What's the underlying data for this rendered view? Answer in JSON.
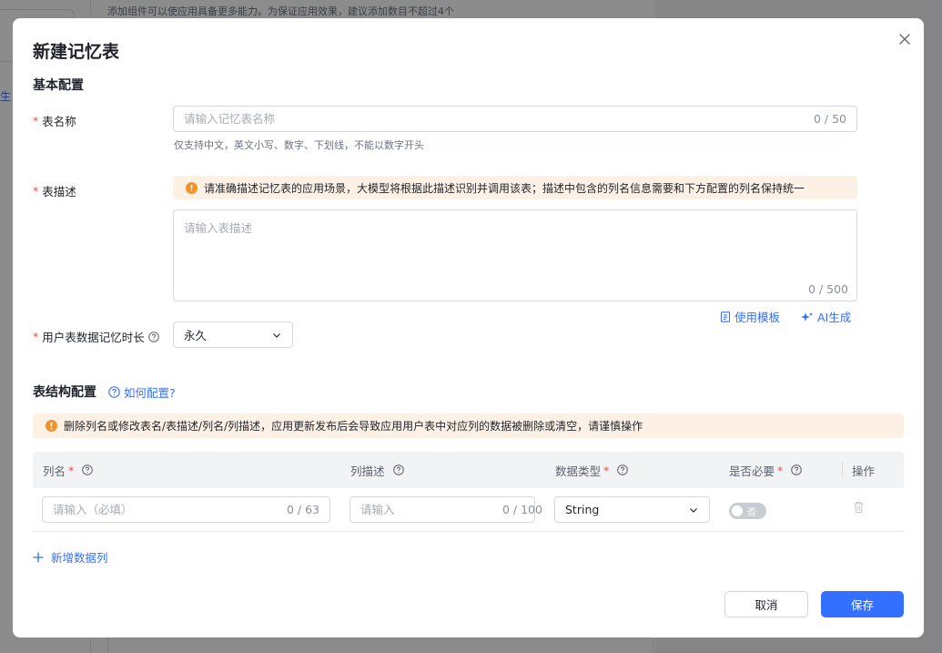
{
  "background": {
    "hint": "添加组件可以使应用具备更多能力。为保证应用效果，建议添加数目不超过4个",
    "left_text": "生"
  },
  "modal": {
    "title": "新建记忆表",
    "close_icon": "close-icon"
  },
  "basic": {
    "section_title": "基本配置",
    "required_mark": "*",
    "name": {
      "label": "表名称",
      "placeholder": "请输入记忆表名称",
      "value": "",
      "counter": "0 / 50",
      "hint": "仅支持中文，英文小写、数字、下划线，不能以数字开头"
    },
    "description": {
      "label": "表描述",
      "warning": "请准确描述记忆表的应用场景，大模型将根据此描述识别并调用该表；描述中包含的列名信息需要和下方配置的列名保持统一",
      "placeholder": "请输入表描述",
      "value": "",
      "counter": "0 / 500",
      "use_template": "使用模板",
      "ai_generate": "AI生成"
    },
    "retention": {
      "label": "用户表数据记忆时长",
      "selected": "永久"
    }
  },
  "structure": {
    "section_title": "表结构配置",
    "help_link": "如何配置?",
    "warning": "删除列名或修改表名/表描述/列名/列描述，应用更新发布后会导致应用用户表中对应列的数据被删除或清空，请谨慎操作",
    "columns": {
      "name": "列名",
      "desc": "列描述",
      "type": "数据类型",
      "required": "是否必要",
      "action": "操作"
    },
    "rows": [
      {
        "name_placeholder": "请输入（必填）",
        "name_counter": "0 / 63",
        "desc_placeholder": "请输入",
        "desc_counter": "0 / 100",
        "type": "String",
        "required_label": "否",
        "required_on": false
      }
    ],
    "add_column": "新增数据列"
  },
  "footer": {
    "cancel": "取消",
    "save": "保存"
  },
  "colors": {
    "primary": "#3370ff",
    "warning": "#f0942a",
    "warning_bg": "#fdf1e6",
    "required": "#f54a45"
  }
}
